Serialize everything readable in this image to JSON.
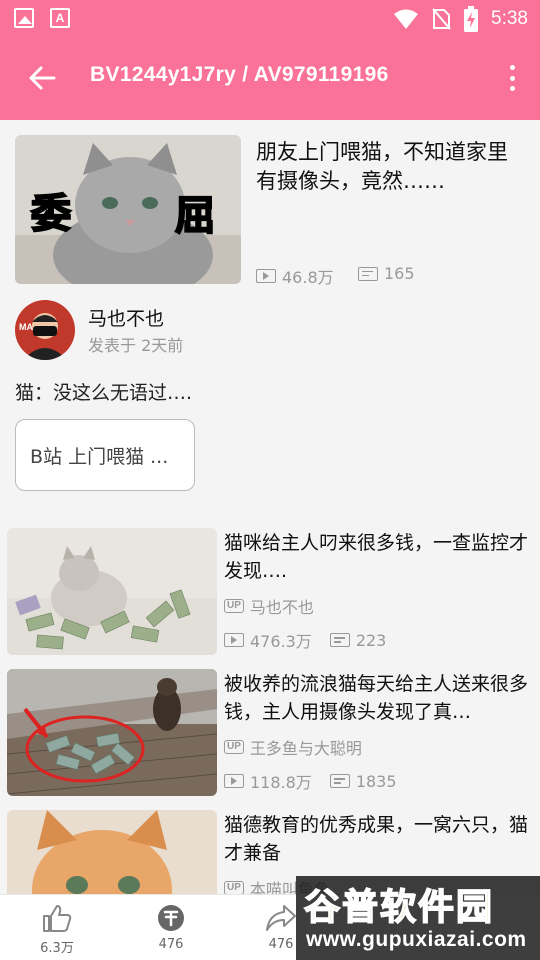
{
  "status_bar": {
    "time": "5:38"
  },
  "toolbar": {
    "title": "BV1244y1J7ry / AV979119196"
  },
  "hero": {
    "title": "朋友上门喂猫，不知道家里有摄像头，竟然……",
    "thumb_text_left": "委",
    "thumb_text_right": "屈",
    "views": "46.8万",
    "danmaku": "165"
  },
  "author": {
    "name": "马也不也",
    "posted": "发表于 2天前"
  },
  "description": "猫：没这么无语过….",
  "tag": {
    "label": "B站 上门喂猫 ..."
  },
  "related": [
    {
      "title": "猫咪给主人叼来很多钱，一查监控才发现….",
      "up": "马也不也",
      "views": "476.3万",
      "danmaku": "223"
    },
    {
      "title": "被收养的流浪猫每天给主人送来很多钱，主人用摄像头发现了真…",
      "up": "王多鱼与大聪明",
      "views": "118.8万",
      "danmaku": "1835"
    },
    {
      "title": "猫德教育的优秀成果，一窝六只，猫才兼备",
      "up": "本喵叫鱼鱼",
      "views": "",
      "danmaku": ""
    }
  ],
  "bottom_bar": {
    "like": "6.3万",
    "coin": "476",
    "share": "476"
  },
  "watermark": {
    "text": "谷普软件园",
    "url": "www.gupuxiazai.com"
  },
  "colors": {
    "accent": "#fb7299",
    "watermark_green": "#7cc242"
  }
}
